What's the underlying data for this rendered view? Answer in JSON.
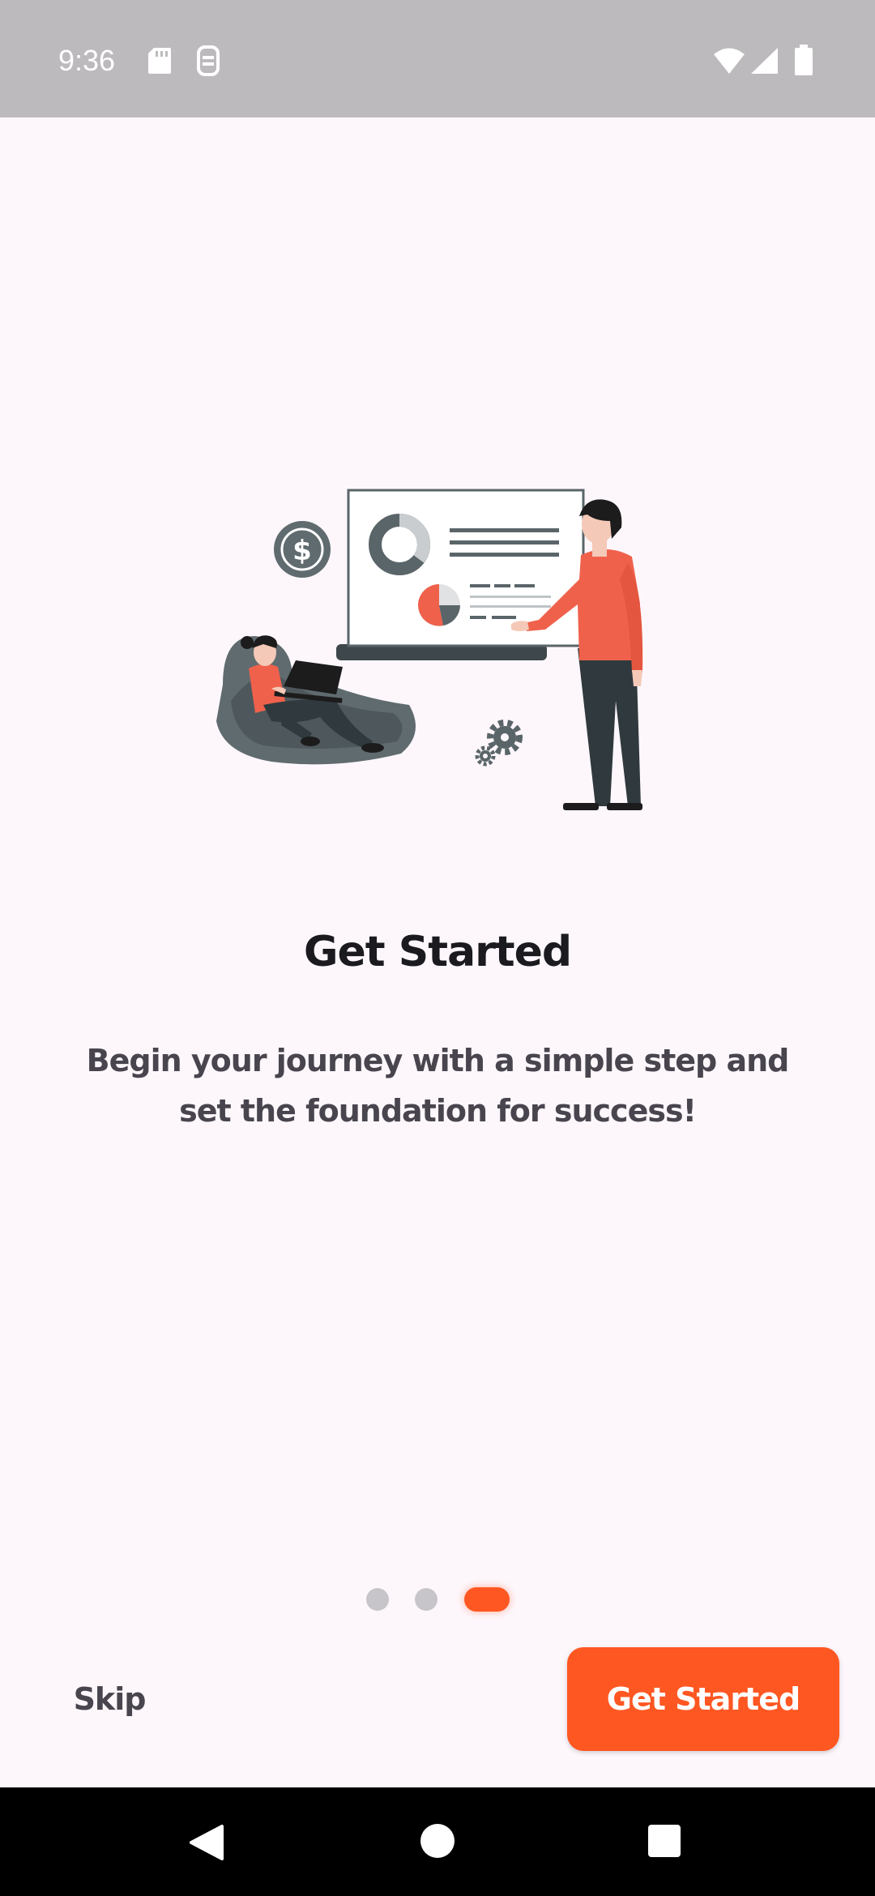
{
  "status_bar": {
    "time": "9:36",
    "icons": [
      "sd-card-icon",
      "storage-icon",
      "wifi-icon",
      "signal-icon",
      "battery-icon"
    ]
  },
  "onboarding": {
    "illustration": "presentation-illustration",
    "title": "Get Started",
    "description": "Begin your journey with a simple step and set the foundation for success!",
    "page_indicator": {
      "total": 3,
      "current": 3
    }
  },
  "actions": {
    "skip_label": "Skip",
    "primary_label": "Get Started"
  },
  "nav_bar": {
    "icons": [
      "back-icon",
      "home-icon",
      "recents-icon"
    ]
  },
  "colors": {
    "accent": "#FF5722",
    "background": "#FDF7FC",
    "status_bar": "#BDBABD",
    "indicator_inactive": "#C7C5CA"
  }
}
